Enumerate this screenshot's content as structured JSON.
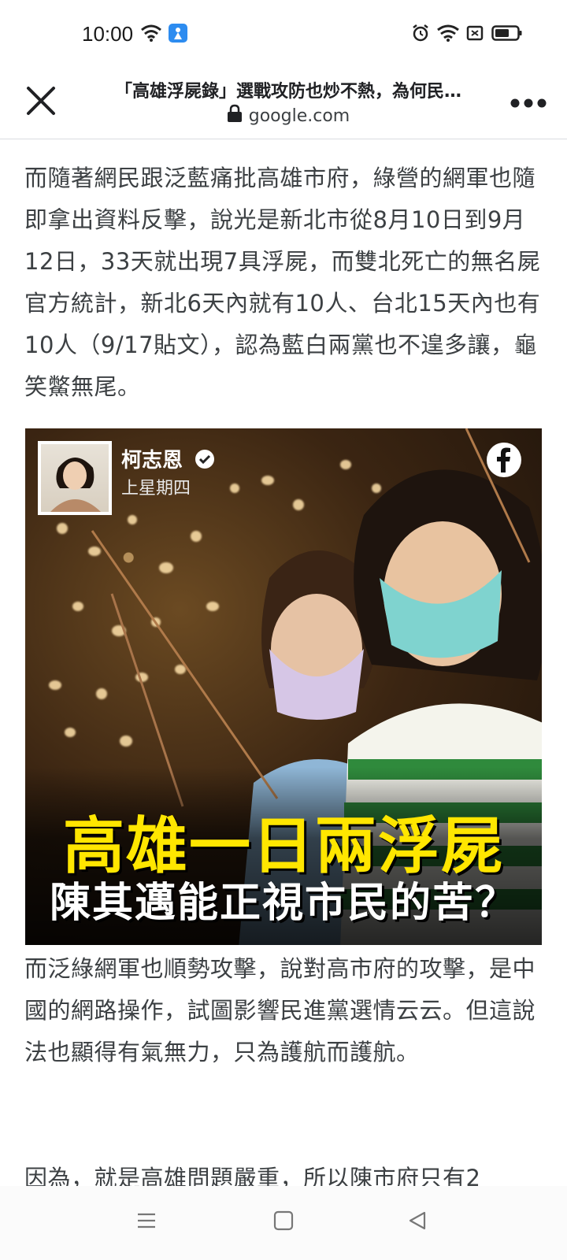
{
  "status_bar": {
    "time": "10:00",
    "icons": [
      "wifi-icon",
      "app-notification-icon",
      "alarm-icon",
      "wifi-signal-icon",
      "sim-icon",
      "battery-icon"
    ]
  },
  "title_bar": {
    "title": "「高雄浮屍錄」選戰攻防也炒不熱，為何民…",
    "url": "google.com",
    "icons": [
      "close-icon",
      "lock-icon",
      "more-options-icon"
    ]
  },
  "article": {
    "para1": "而隨著網民跟泛藍痛批高雄市府，綠營的網軍也隨即拿出資料反擊，說光是新北市從8月10日到9月12日，33天就出現7具浮屍，而雙北死亡的無名屍官方統計，新北6天內就有10人、台北15天內也有10人（9/17貼文），認為藍白兩黨也不遑多讓，龜笑鱉無尾。",
    "para2": "而泛綠網軍也順勢攻擊，說對高市府的攻擊，是中國的網路操作，試圖影響民進黨選情云云。但這說法也顯得有氣無力，只為護航而護航。",
    "para3": "因為，就是高雄問題嚴重，所以陳市府只有2"
  },
  "embed": {
    "author": "柯志恩",
    "date": "上星期四",
    "headline1": "高雄一日兩浮屍",
    "headline2": "陳其邁能正視市民的苦？",
    "icons": [
      "avatar",
      "verified-badge-icon",
      "facebook-icon"
    ]
  },
  "nav_bar": {
    "icons": [
      "menu-icon",
      "home-icon",
      "back-icon"
    ]
  }
}
